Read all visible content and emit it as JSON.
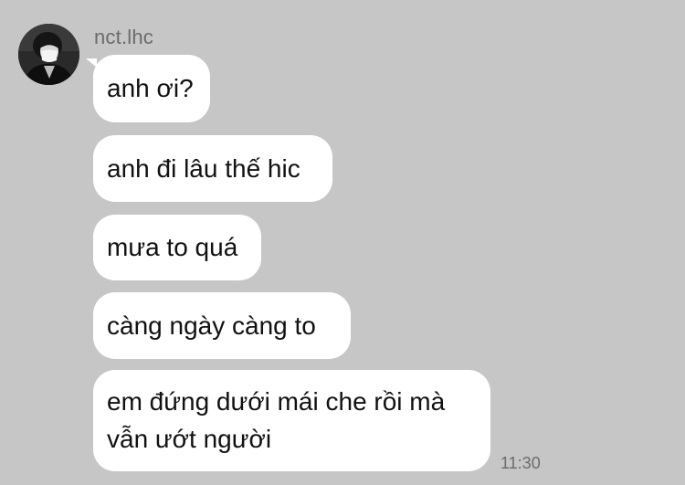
{
  "contact": {
    "name": "nct.lhc",
    "avatar_icon": "profile-photo-masked-person"
  },
  "messages": [
    {
      "text": "anh ơi?"
    },
    {
      "text": "anh đi lâu thế hic"
    },
    {
      "text": "mưa to quá"
    },
    {
      "text": "càng ngày càng to"
    },
    {
      "text": "em đứng dưới mái che rồi mà vẫn ướt người"
    }
  ],
  "last_message_time": "11:30",
  "colors": {
    "background": "#c6c6c6",
    "bubble": "#ffffff",
    "meta_text": "#6b6b6b"
  }
}
